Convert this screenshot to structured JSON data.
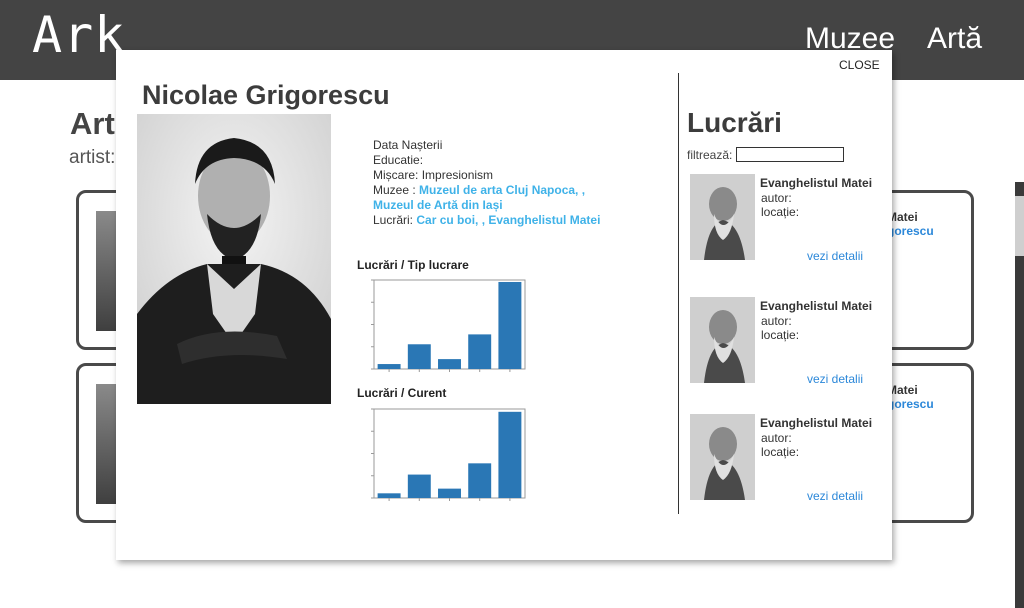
{
  "header": {
    "logo": "Ark",
    "nav": [
      "Muzee",
      "Artă"
    ]
  },
  "background": {
    "title": "Art",
    "subtitle": "artist:",
    "cards": [
      {
        "name": "Matei",
        "link": "gorescu"
      },
      {
        "name": "Matei",
        "link": "gorescu"
      }
    ]
  },
  "modal": {
    "close_label": "CLOSE",
    "artist_name": "Nicolae Grigorescu",
    "info": {
      "birth_label": "Data Nașterii",
      "education_label": "Educatie:",
      "movement_label": "Mișcare:",
      "movement_value": "Impresionism",
      "museums_label": "Muzee :",
      "museums_value": "Muzeul de arta Cluj Napoca, , Muzeul de Artă din Iași",
      "works_label": "Lucrări:",
      "works_value": "Car cu boi, , Evanghelistul Matei"
    },
    "chart_titles": [
      "Lucrări / Tip lucrare",
      "Lucrări / Curent"
    ],
    "works_title": "Lucrări",
    "filter_label": "filtrează:",
    "filter_value": "",
    "works": [
      {
        "name": "Evanghelistul Matei",
        "author_label": "autor:",
        "location_label": "locație:",
        "details_label": "vezi detalii"
      },
      {
        "name": "Evanghelistul Matei",
        "author_label": "autor:",
        "location_label": "locație:",
        "details_label": "vezi detalii"
      },
      {
        "name": "Evanghelistul Matei",
        "author_label": "autor:",
        "location_label": "locație:",
        "details_label": "vezi detalii"
      }
    ]
  },
  "colors": {
    "topbar": "#444444",
    "link": "#3fb2e8",
    "details": "#2c88d9",
    "bar": "#2a77b5"
  },
  "chart_data": [
    {
      "type": "bar",
      "title": "Lucrări / Tip lucrare",
      "categories": [
        "",
        "",
        "",
        "",
        ""
      ],
      "values": [
        0.5,
        2.5,
        1,
        3.5,
        8.8
      ],
      "ylim": [
        0,
        9
      ]
    },
    {
      "type": "bar",
      "title": "Lucrări / Curent",
      "categories": [
        "",
        "",
        "",
        "",
        ""
      ],
      "values": [
        0.5,
        2.5,
        1,
        3.7,
        9.2
      ],
      "ylim": [
        0,
        9.5
      ]
    }
  ]
}
